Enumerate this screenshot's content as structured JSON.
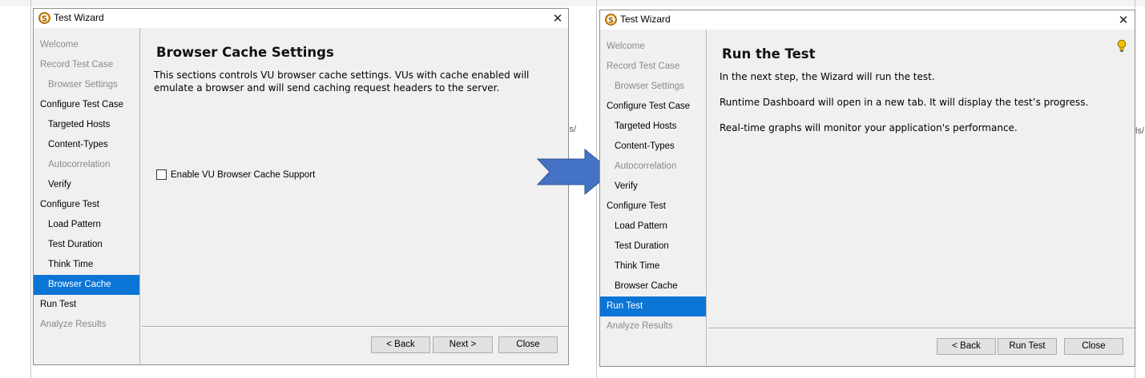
{
  "colors": {
    "selected_bg": "#0b75d6",
    "arrow": "#4472c4",
    "disabled_text": "#8a8a8a",
    "bulb": "#f2c200"
  },
  "left_window": {
    "title": "Test Wizard",
    "icon": "app-s-logo-icon",
    "nav": [
      {
        "label": "Welcome",
        "level": 0,
        "state": "disabled"
      },
      {
        "label": "Record Test Case",
        "level": 0,
        "state": "disabled"
      },
      {
        "label": "Browser Settings",
        "level": 1,
        "state": "disabled"
      },
      {
        "label": "Configure Test Case",
        "level": 0,
        "state": "normal"
      },
      {
        "label": "Targeted Hosts",
        "level": 1,
        "state": "normal"
      },
      {
        "label": "Content-Types",
        "level": 1,
        "state": "normal"
      },
      {
        "label": "Autocorrelation",
        "level": 1,
        "state": "disabled"
      },
      {
        "label": "Verify",
        "level": 1,
        "state": "normal"
      },
      {
        "label": "Configure Test",
        "level": 0,
        "state": "normal"
      },
      {
        "label": "Load Pattern",
        "level": 1,
        "state": "normal"
      },
      {
        "label": "Test Duration",
        "level": 1,
        "state": "normal"
      },
      {
        "label": "Think Time",
        "level": 1,
        "state": "normal"
      },
      {
        "label": "Browser Cache",
        "level": 1,
        "state": "selected"
      },
      {
        "label": "Run Test",
        "level": 0,
        "state": "normal"
      },
      {
        "label": "Analyze Results",
        "level": 0,
        "state": "disabled"
      }
    ],
    "page_title": "Browser Cache Settings",
    "description_line1": "This sections controls VU browser cache settings. VUs with cache enabled will",
    "description_line2": "emulate a browser and will send caching request headers to the server.",
    "checkbox_label": "Enable VU Browser Cache Support",
    "checkbox_checked": false,
    "buttons": {
      "back": "< Back",
      "next": "Next >",
      "close": "Close"
    }
  },
  "right_window": {
    "title": "Test Wizard",
    "icon": "app-s-logo-icon",
    "nav": [
      {
        "label": "Welcome",
        "level": 0,
        "state": "disabled"
      },
      {
        "label": "Record Test Case",
        "level": 0,
        "state": "disabled"
      },
      {
        "label": "Browser Settings",
        "level": 1,
        "state": "disabled"
      },
      {
        "label": "Configure Test Case",
        "level": 0,
        "state": "normal"
      },
      {
        "label": "Targeted Hosts",
        "level": 1,
        "state": "normal"
      },
      {
        "label": "Content-Types",
        "level": 1,
        "state": "normal"
      },
      {
        "label": "Autocorrelation",
        "level": 1,
        "state": "disabled"
      },
      {
        "label": "Verify",
        "level": 1,
        "state": "normal"
      },
      {
        "label": "Configure Test",
        "level": 0,
        "state": "normal"
      },
      {
        "label": "Load Pattern",
        "level": 1,
        "state": "normal"
      },
      {
        "label": "Test Duration",
        "level": 1,
        "state": "normal"
      },
      {
        "label": "Think Time",
        "level": 1,
        "state": "normal"
      },
      {
        "label": "Browser Cache",
        "level": 1,
        "state": "normal"
      },
      {
        "label": "Run Test",
        "level": 0,
        "state": "selected"
      },
      {
        "label": "Analyze Results",
        "level": 0,
        "state": "disabled"
      }
    ],
    "page_title": "Run the Test",
    "lines": [
      "In the next step, the Wizard will run the test.",
      "Runtime Dashboard will open in a new tab. It will display the test’s progress.",
      "Real-time graphs will monitor your application's performance."
    ],
    "hint_icon": "lightbulb-icon",
    "buttons": {
      "back": "< Back",
      "run": "Run Test",
      "close": "Close"
    }
  },
  "background": {
    "fragment_left": "ls/",
    "fragment_right": "ls/"
  }
}
